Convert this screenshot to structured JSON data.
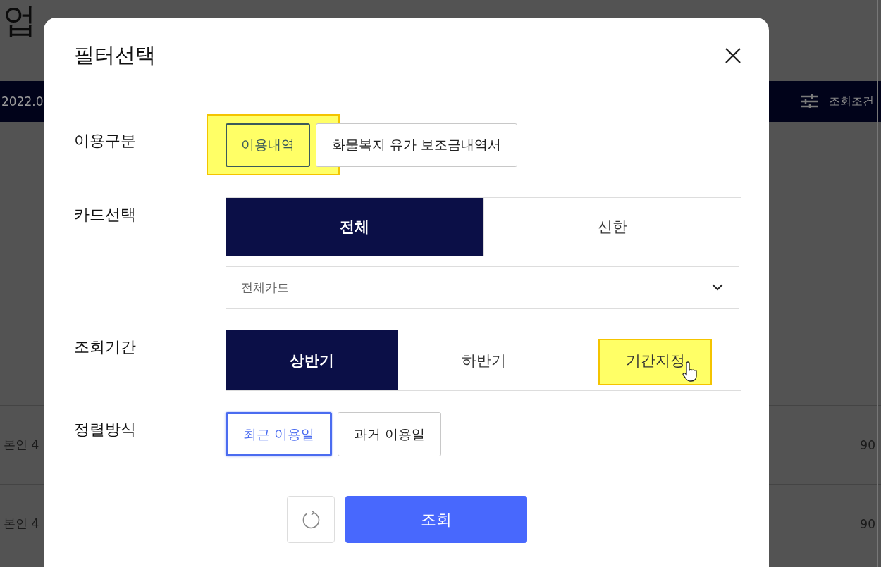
{
  "background": {
    "page_title": "업",
    "date_text": "2022.0",
    "filter_label": "조회조건",
    "rows": [
      {
        "owner": "본인 4",
        "amount": "90"
      },
      {
        "owner": "본인 4",
        "amount": "90"
      }
    ]
  },
  "dialog": {
    "title": "필터선택",
    "sections": [
      {
        "kind": "buttons",
        "label": "이용구분",
        "options": [
          {
            "label": "이용내역",
            "selected": true,
            "highlight": true
          },
          {
            "label": "화물복지 유가 보조금내역서",
            "selected": false,
            "highlight": false
          }
        ]
      },
      {
        "kind": "segmented",
        "label": "카드선택",
        "options": [
          {
            "label": "전체",
            "selected": true,
            "highlight": false,
            "pointer": false
          },
          {
            "label": "신한",
            "selected": false,
            "highlight": false,
            "pointer": false
          }
        ],
        "dropdown": {
          "value": "전체카드"
        }
      },
      {
        "kind": "segmented",
        "label": "조회기간",
        "options": [
          {
            "label": "상반기",
            "selected": true,
            "highlight": false,
            "pointer": false
          },
          {
            "label": "하반기",
            "selected": false,
            "highlight": false,
            "pointer": false
          },
          {
            "label": "기간지정",
            "selected": false,
            "highlight": true,
            "pointer": true
          }
        ]
      },
      {
        "kind": "buttons",
        "label": "정렬방식",
        "options": [
          {
            "label": "최근 이용일",
            "selected": true,
            "highlight": false
          },
          {
            "label": "과거 이용일",
            "selected": false,
            "highlight": false
          }
        ]
      }
    ],
    "submit_label": "조회"
  }
}
